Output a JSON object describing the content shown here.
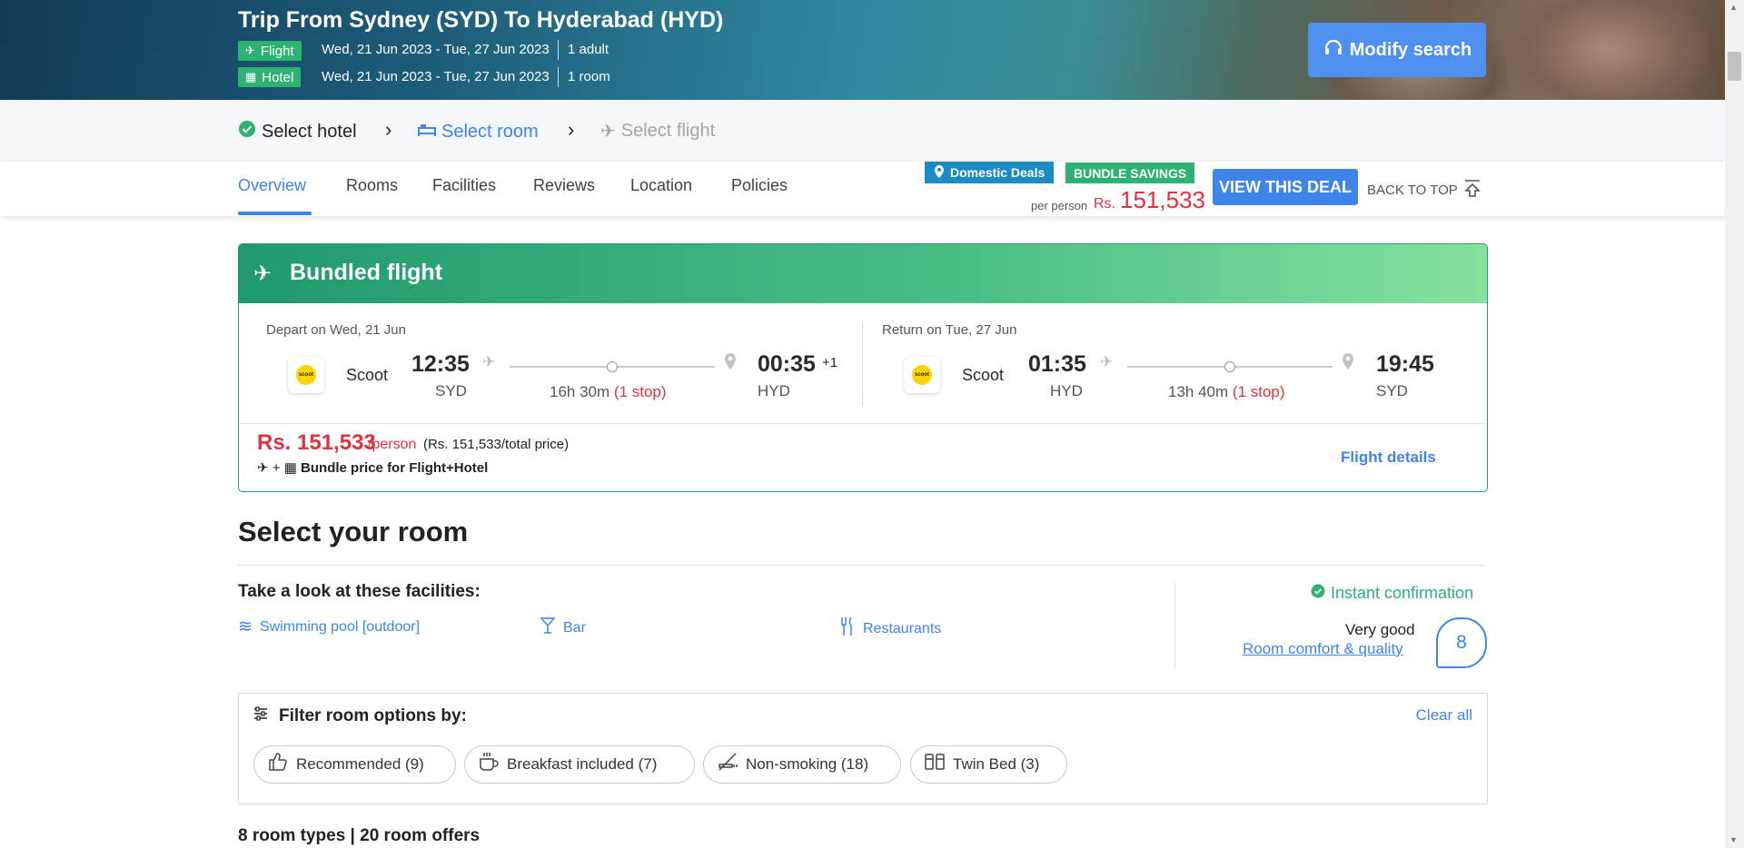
{
  "header": {
    "title": "Trip From Sydney (SYD) To Hyderabad (HYD)",
    "flight_tag": "Flight",
    "flight_dates": "Wed, 21 Jun 2023 - Tue, 27 Jun 2023",
    "flight_pax": "1 adult",
    "hotel_tag": "Hotel",
    "hotel_dates": "Wed, 21 Jun 2023 - Tue, 27 Jun 2023",
    "hotel_rooms": "1 room",
    "modify_label": "Modify search"
  },
  "steps": [
    {
      "label": "Select hotel",
      "state": "done"
    },
    {
      "label": "Select room",
      "state": "active"
    },
    {
      "label": "Select flight",
      "state": "pending"
    }
  ],
  "tabs": [
    {
      "label": "Overview"
    },
    {
      "label": "Rooms"
    },
    {
      "label": "Facilities"
    },
    {
      "label": "Reviews"
    },
    {
      "label": "Location"
    },
    {
      "label": "Policies"
    }
  ],
  "deal": {
    "domestic_label": "Domestic Deals",
    "bundle_label": "BUNDLE SAVINGS",
    "per_person": "per person",
    "currency": "Rs.",
    "price": "151,533",
    "view_label": "VIEW THIS DEAL",
    "back_top": "BACK TO TOP"
  },
  "flight_card": {
    "title": "Bundled flight",
    "depart": {
      "label": "Depart on Wed, 21 Jun",
      "airline": "Scoot",
      "dep_time": "12:35",
      "dep_code": "SYD",
      "duration": "16h 30m",
      "stops": "(1 stop)",
      "arr_time": "00:35",
      "arr_plus": "+1",
      "arr_code": "HYD"
    },
    "return": {
      "label": "Return on Tue, 27 Jun",
      "airline": "Scoot",
      "dep_time": "01:35",
      "dep_code": "HYD",
      "duration": "13h 40m",
      "stops": "(1 stop)",
      "arr_time": "19:45",
      "arr_code": "SYD"
    },
    "logo_text": "scoot",
    "price": "Rs. 151,533",
    "per_person": "/person",
    "total_price": "(Rs. 151,533/total price)",
    "bundle_note": "Bundle price for Flight+Hotel",
    "details_link": "Flight details"
  },
  "room_section": {
    "title": "Select your room",
    "facilities_title": "Take a look at these facilities:",
    "facilities": [
      {
        "label": "Swimming pool [outdoor]",
        "icon": "pool-icon"
      },
      {
        "label": "Bar",
        "icon": "cocktail-icon"
      },
      {
        "label": "Restaurants",
        "icon": "cutlery-icon"
      }
    ],
    "instant": "Instant confirmation",
    "rating_text": "Very good",
    "rating_link": "Room comfort & quality",
    "score": "8"
  },
  "filter": {
    "title": "Filter room options by:",
    "clear": "Clear all",
    "chips": [
      {
        "label": "Recommended (9)",
        "icon": "thumbs-up-icon"
      },
      {
        "label": "Breakfast included (7)",
        "icon": "coffee-icon"
      },
      {
        "label": "Non-smoking (18)",
        "icon": "no-smoking-icon"
      },
      {
        "label": "Twin Bed (3)",
        "icon": "twin-bed-icon"
      }
    ]
  },
  "room_count": "8 room types | 20 room offers",
  "colors": {
    "accent": "#3f84ea",
    "green": "#2cb374",
    "price_red": "#e2323d"
  }
}
